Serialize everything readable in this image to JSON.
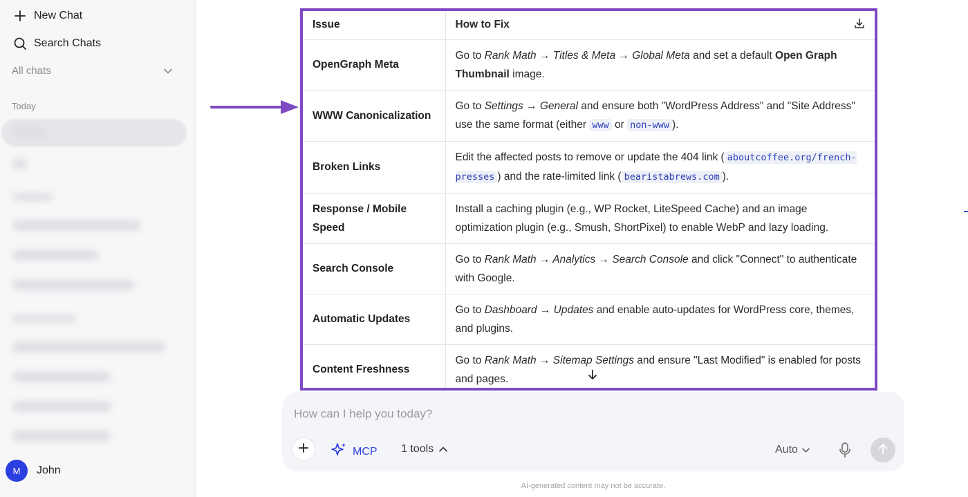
{
  "sidebar": {
    "new_chat": "New Chat",
    "search_chats": "Search Chats",
    "all_chats": "All chats",
    "today": "Today",
    "user": {
      "initial": "M",
      "name": "John"
    }
  },
  "table": {
    "headers": {
      "issue": "Issue",
      "fix": "How to Fix"
    },
    "rows": [
      {
        "issue": "OpenGraph Meta"
      },
      {
        "issue": "WWW Canonicalization"
      },
      {
        "issue": "Broken Links"
      },
      {
        "issue": "Response / Mobile Speed"
      },
      {
        "issue": "Search Console"
      },
      {
        "issue": "Automatic Updates"
      },
      {
        "issue": "Content Freshness"
      }
    ],
    "fix_texts": {
      "r0": {
        "a": "Go to ",
        "b": "Rank Math → Titles & Meta → Global Meta",
        "c": " and set a default ",
        "d": "Open Graph Thumbnail",
        "e": " image."
      },
      "r1": {
        "a": "Go to ",
        "b": "Settings → General",
        "c": " and ensure both \"WordPress Address\" and \"Site Address\" use the same format (either ",
        "code1": "www",
        "d": " or ",
        "code2": "non-www",
        "e": ")."
      },
      "r2": {
        "a": "Edit the affected posts to remove or update the 404 link (",
        "code1": "aboutcoffee.org/french-presses",
        "b": ") and the rate-limited link (",
        "code2": "bearistabrews.com",
        "c": ")."
      },
      "r3": {
        "a": "Install a caching plugin (e.g., WP Rocket, LiteSpeed Cache) and an image optimization plugin (e.g., Smush, ShortPixel) to enable WebP and lazy loading."
      },
      "r4": {
        "a": "Go to ",
        "b": "Rank Math → Analytics → Search Console",
        "c": " and click \"Connect\" to authenticate with Google."
      },
      "r5": {
        "a": "Go to ",
        "b": "Dashboard → Updates",
        "c": " and enable auto-updates for WordPress core, themes, and plugins."
      },
      "r6": {
        "a": "Go to ",
        "b": "Rank Math → Sitemap Settings",
        "c": " and ensure \"Last Modified\" is enabled for posts and pages."
      }
    }
  },
  "composer": {
    "placeholder": "How can I help you today?",
    "mcp_label": "MCP",
    "tools_label": "1 tools",
    "model_label": "Auto"
  },
  "footer": {
    "disclaimer": "AI-generated content may not be accurate."
  },
  "colors": {
    "accent": "#2e40e6",
    "highlight_frame": "#7e4bc4",
    "arrow": "#7e4bc4"
  }
}
